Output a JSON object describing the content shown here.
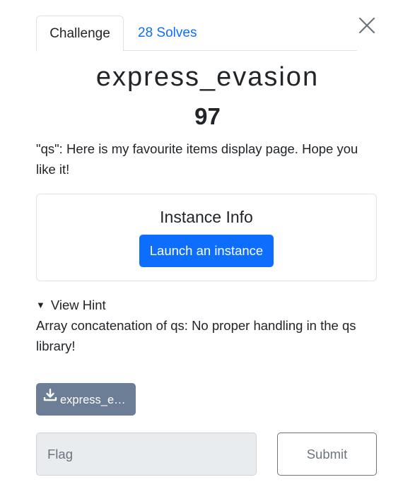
{
  "tabs": {
    "challenge_label": "Challenge",
    "solves_label": "28 Solves"
  },
  "challenge": {
    "name": "express_evasion",
    "value": "97",
    "description": "\"qs\": Here is my favourite items display page. Hope you like it!"
  },
  "instance": {
    "title": "Instance Info",
    "launch_label": "Launch an instance"
  },
  "hint": {
    "toggle_label": "View Hint",
    "text": "Array concatenation of qs: No proper handling in the qs library!"
  },
  "files": [
    {
      "label": "express_evasion.zip"
    }
  ],
  "flag": {
    "placeholder": "Flag",
    "submit_label": "Submit"
  },
  "colors": {
    "primary": "#0d6efd",
    "file_button": "#6c7d96",
    "input_bg": "#e9ecef"
  },
  "icons": [
    "close-icon",
    "caret-down-icon",
    "download-icon"
  ]
}
